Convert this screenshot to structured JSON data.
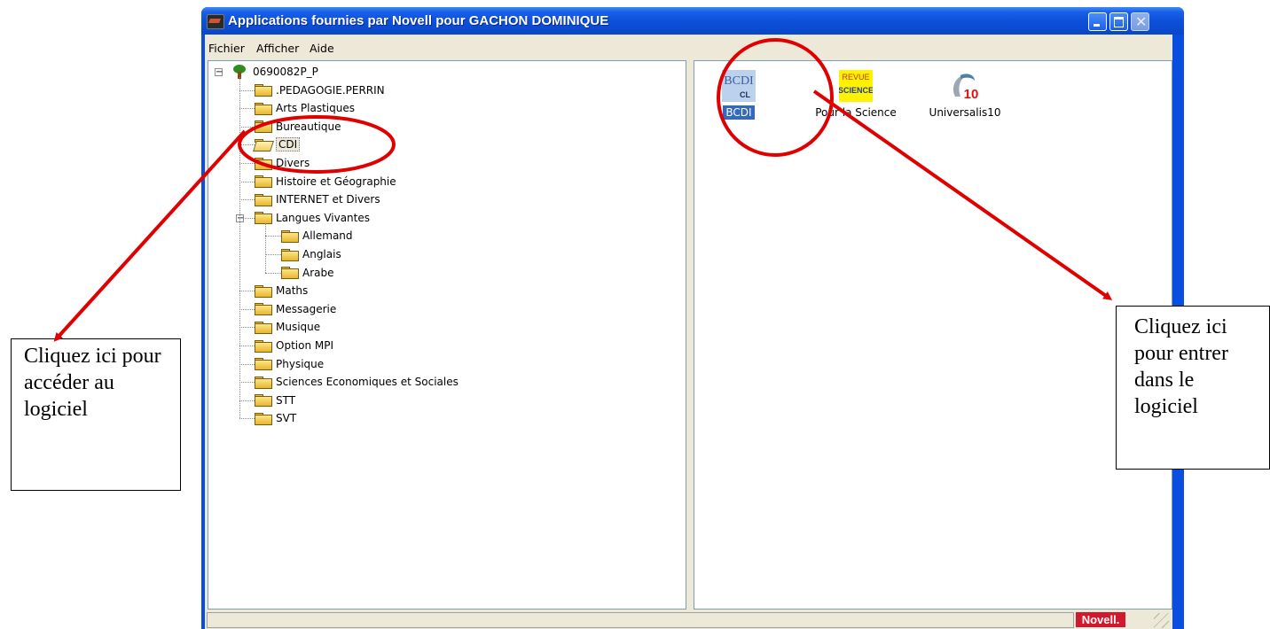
{
  "window": {
    "title": "Applications fournies par Novell pour GACHON DOMINIQUE",
    "controls": {
      "close_glyph": "✕"
    }
  },
  "menu": [
    "Fichier",
    "Afficher",
    "Aide"
  ],
  "tree": {
    "root": "0690082P_P",
    "items": [
      {
        "label": ".PEDAGOGIE.PERRIN",
        "level": 1
      },
      {
        "label": "Arts Plastiques",
        "level": 1
      },
      {
        "label": "Bureautique",
        "level": 1
      },
      {
        "label": "CDI",
        "level": 1,
        "selected": true,
        "open": true
      },
      {
        "label": "Divers",
        "level": 1
      },
      {
        "label": "Histoire et Géographie",
        "level": 1
      },
      {
        "label": "INTERNET et Divers",
        "level": 1
      },
      {
        "label": "Langues Vivantes",
        "level": 1,
        "expanded": true
      },
      {
        "label": "Allemand",
        "level": 2
      },
      {
        "label": "Anglais",
        "level": 2
      },
      {
        "label": "Arabe",
        "level": 2
      },
      {
        "label": "Maths",
        "level": 1
      },
      {
        "label": "Messagerie",
        "level": 1
      },
      {
        "label": "Musique",
        "level": 1
      },
      {
        "label": "Option MPI",
        "level": 1
      },
      {
        "label": "Physique",
        "level": 1
      },
      {
        "label": "Sciences Economiques et Sociales",
        "level": 1
      },
      {
        "label": "STT",
        "level": 1
      },
      {
        "label": "SVT",
        "level": 1
      }
    ]
  },
  "apps": [
    {
      "label": "BCDI",
      "icon": "bcdi-icon",
      "icon_text": "BCDI",
      "icon_sub": "CL",
      "selected": true
    },
    {
      "label": "Pour la Science",
      "icon": "pour-la-science-icon",
      "icon_text": "REVUE",
      "icon_sub": "SCIENCE"
    },
    {
      "label": "Universalis10",
      "icon": "universalis-icon",
      "icon_text": "10"
    }
  ],
  "status": {
    "brand": "Novell."
  },
  "callouts": {
    "left": "Cliquez ici pour accéder au logiciel",
    "right": "Cliquez ici pour entrer dans le logiciel"
  },
  "colors": {
    "title_bar": "#0a4ee0",
    "selection": "#316ac5",
    "annotation_red": "#e00000",
    "novell_red": "#d2182c"
  }
}
